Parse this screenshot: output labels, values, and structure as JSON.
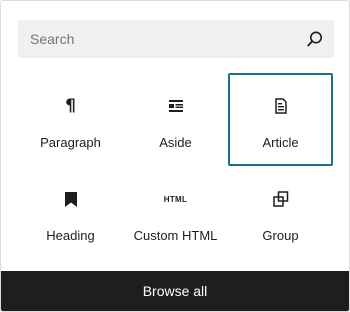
{
  "search": {
    "placeholder": "Search",
    "icon": "search-icon"
  },
  "blocks": [
    {
      "label": "Paragraph",
      "icon": "paragraph-icon",
      "selected": false
    },
    {
      "label": "Aside",
      "icon": "aside-icon",
      "selected": false
    },
    {
      "label": "Article",
      "icon": "article-icon",
      "selected": true
    },
    {
      "label": "Heading",
      "icon": "heading-bookmark-icon",
      "selected": false
    },
    {
      "label": "Custom HTML",
      "icon": "html-icon",
      "icon_text": "HTML",
      "selected": false
    },
    {
      "label": "Group",
      "icon": "group-icon",
      "selected": false
    }
  ],
  "footer": {
    "browse_all_label": "Browse all"
  },
  "colors": {
    "selected_border": "#1a6f8a",
    "footer_bg": "#1e1e1e",
    "search_bg": "#f0f0f0"
  }
}
